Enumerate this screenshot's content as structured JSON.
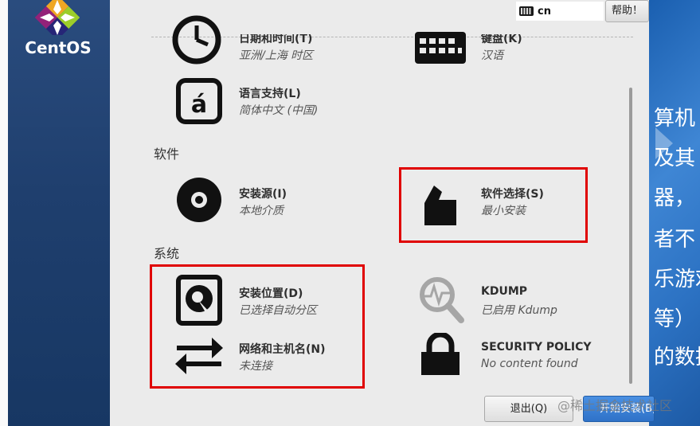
{
  "brand": {
    "name": "CentOS"
  },
  "keyboard": {
    "layout": "cn"
  },
  "header": {
    "help_label": "帮助！"
  },
  "sections": {
    "software": "软件",
    "system": "系统"
  },
  "spokes": {
    "datetime": {
      "title": "日期和时间(T)",
      "status": "亚洲/上海 时区"
    },
    "keyboard": {
      "title": "键盘(K)",
      "status": "汉语"
    },
    "language": {
      "title": "语言支持(L)",
      "status": "简体中文 (中国)"
    },
    "source": {
      "title": "安装源(I)",
      "status": "本地介质"
    },
    "software": {
      "title": "软件选择(S)",
      "status": "最小安装"
    },
    "destination": {
      "title": "安装位置(D)",
      "status": "已选择自动分区"
    },
    "kdump": {
      "title": "KDUMP",
      "status": "已启用 Kdump"
    },
    "network": {
      "title": "网络和主机名(N)",
      "status": "未连接"
    },
    "security": {
      "title": "SECURITY POLICY",
      "status": "No content found"
    }
  },
  "footer": {
    "quit_label": "退出(Q)",
    "begin_label": "开始安装(B)"
  },
  "watermark": "@稀土掘金技术社区",
  "background_text": [
    "算机",
    "及其",
    "器，",
    "者不",
    "乐游戏",
    "等）",
    "的数据"
  ],
  "colors": {
    "highlight": "#e00000",
    "sidebar": "#1f3f6e",
    "primary_button": "#3a7fd5"
  }
}
